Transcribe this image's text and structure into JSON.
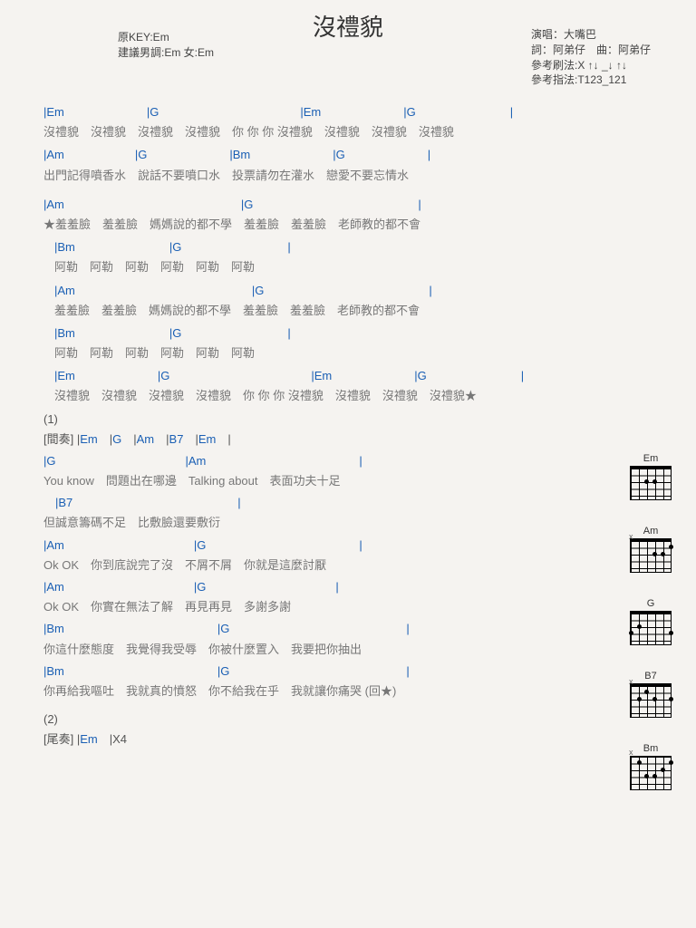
{
  "title": "沒禮貌",
  "meta": {
    "key": "原KEY:Em",
    "sug": "建議男調:Em 女:Em",
    "singer": "演唱：大嘴巴",
    "cred": "詞：阿弟仔　曲：阿弟仔",
    "strum": "參考刷法:X ↑↓ _↓ ↑↓",
    "pick": "參考指法:T123_121"
  },
  "l1c": "|Em　　　　　　　|G　　　　　　　　　　　　|Em　　　　　　　|G　　　　　　　　|",
  "l1": "沒禮貌　沒禮貌　沒禮貌　沒禮貌　你 你 你 沒禮貌　沒禮貌　沒禮貌　沒禮貌",
  "l2c": "|Am　　　　　　|G　　　　　　　|Bm　　　　　　　|G　　　　　　　|",
  "l2": "出門記得噴香水　說話不要噴口水　投票請勿在灌水　戀愛不要忘情水",
  "l3c": "|Am　　　　　　　　　　　　　　　|G　　　　　　　　　　　　　　|",
  "l3": "★羞羞臉　羞羞臉　媽媽說的都不學　羞羞臉　羞羞臉　老師教的都不會",
  "l4c": "|Bm　　　　　　　　|G　　　　　　　　　|",
  "l4": "阿勒　阿勒　阿勒　阿勒　阿勒　阿勒",
  "l5c": "|Am　　　　　　　　　　　　　　　|G　　　　　　　　　　　　　　|",
  "l5": "羞羞臉　羞羞臉　媽媽說的都不學　羞羞臉　羞羞臉　老師教的都不會",
  "l6c": "|Bm　　　　　　　　|G　　　　　　　　　|",
  "l6": "阿勒　阿勒　阿勒　阿勒　阿勒　阿勒",
  "l7c": "|Em　　　　　　　|G　　　　　　　　　　　　|Em　　　　　　　|G　　　　　　　　|",
  "l7": "沒禮貌　沒禮貌　沒禮貌　沒禮貌　你 你 你 沒禮貌　沒禮貌　沒禮貌　沒禮貌★",
  "s1": "(1)",
  "int": "[間奏] |Em　|G　|Am　|B7　|Em　|",
  "l8c": "|G　　　　　　　　　　　|Am　　　　　　　　　　　　　|",
  "l8": "You know　問題出在哪邊　Talking about　表面功夫十足",
  "l9c": "　|B7　　　　　　　　　　　　　　|",
  "l9": "但誠意籌碼不足　比敷臉還要敷衍",
  "l10c": "|Am　　　　　　　　　　　|G　　　　　　　　　　　　　|",
  "l10": "Ok OK　你到底說完了沒　不屑不屑　你就是這麼討厭",
  "l11c": "|Am　　　　　　　　　　　|G　　　　　　　　　　　|",
  "l11": "Ok OK　你實在無法了解　再見再見　多謝多謝",
  "l12c": "|Bm　　　　　　　　　　　　　|G　　　　　　　　　　　　　　　|",
  "l12": "你這什麼態度　我覺得我受辱　你被什麼置入　我要把你抽出",
  "l13c": "|Bm　　　　　　　　　　　　　|G　　　　　　　　　　　　　　　|",
  "l13": "你再給我嘔吐　我就真的憤怒　你不給我在乎　我就讓你痛哭 (回★)",
  "s2": "(2)",
  "out": "[尾奏] |Em　|X4",
  "d": {
    "em": "Em",
    "am": "Am",
    "g": "G",
    "b7": "B7",
    "bm": "Bm"
  }
}
